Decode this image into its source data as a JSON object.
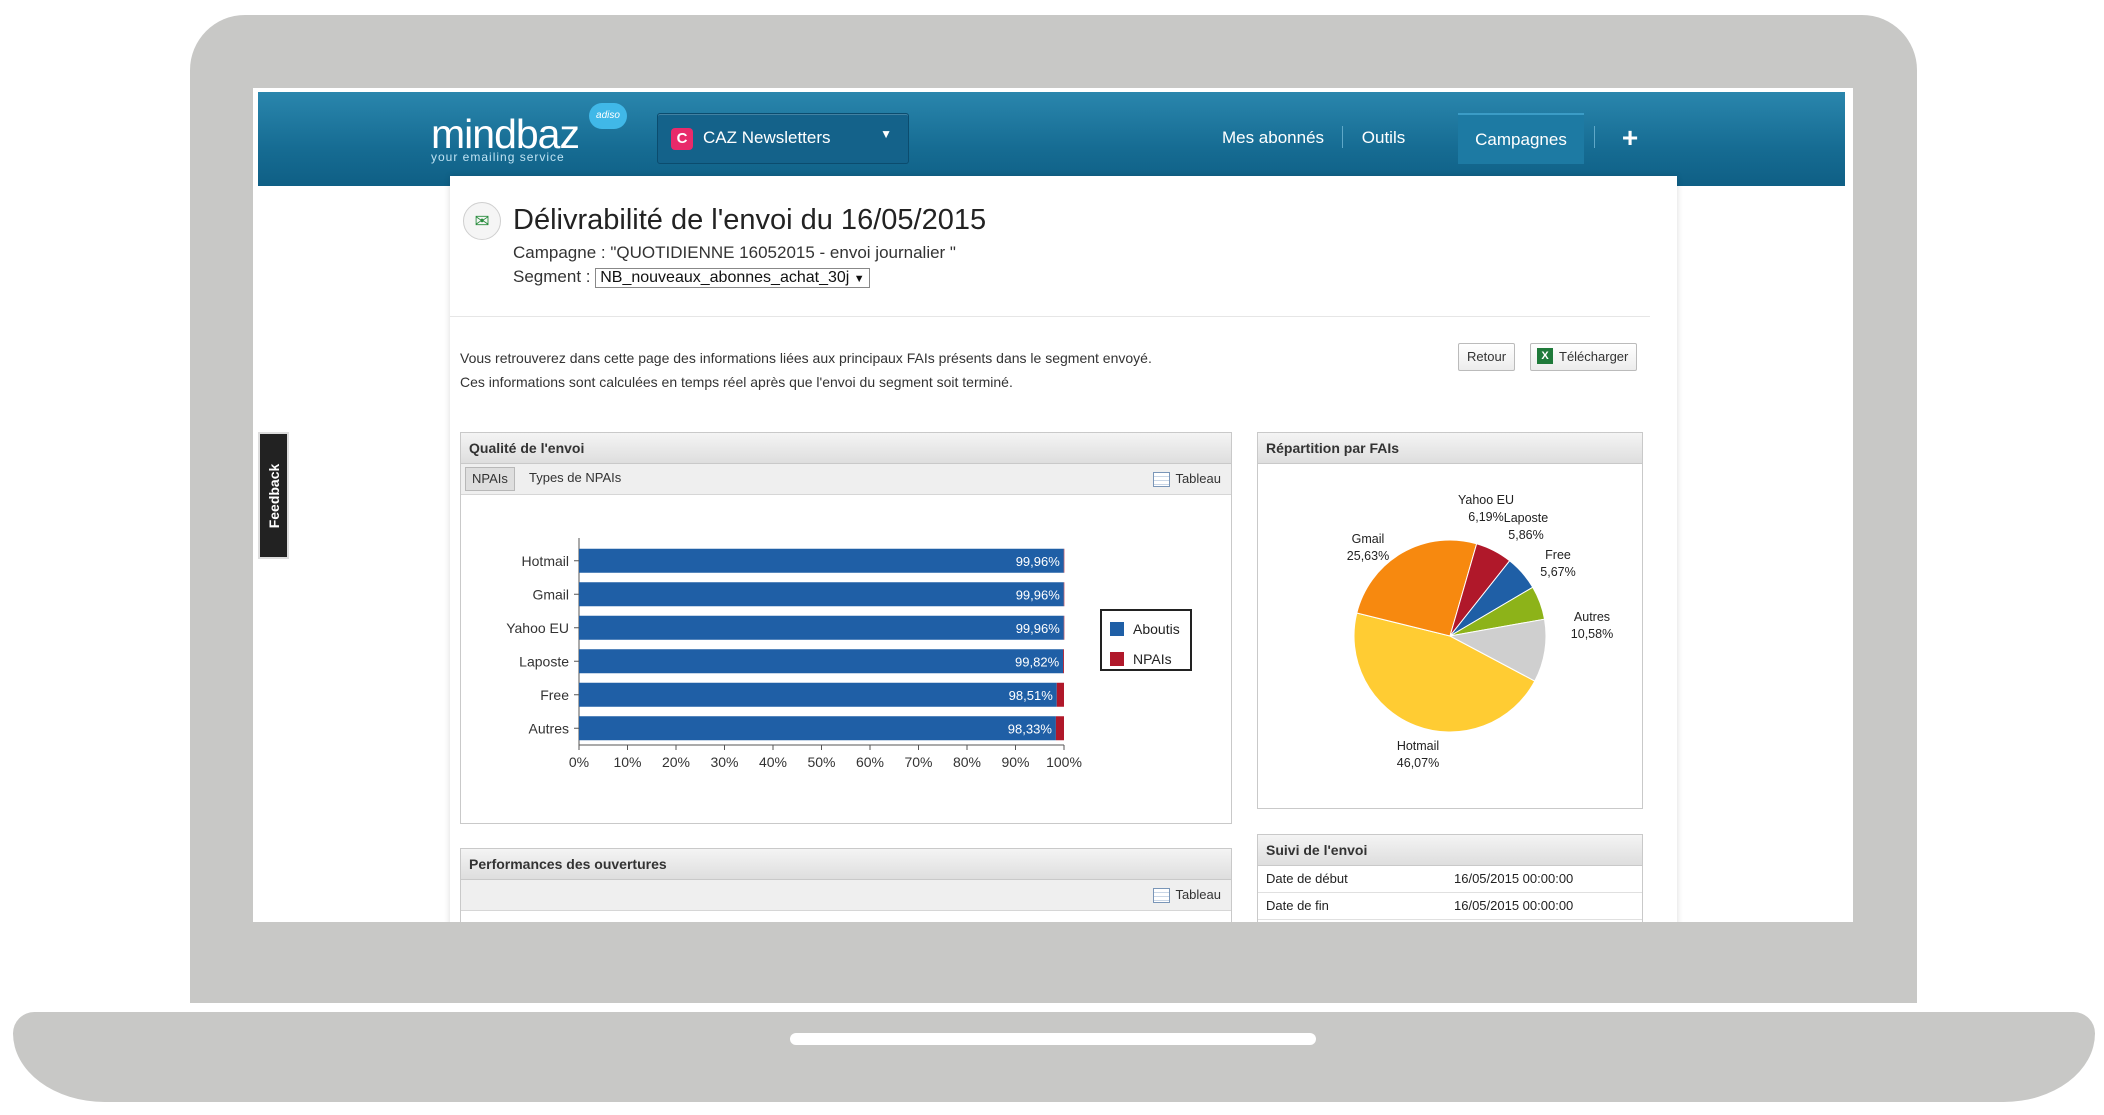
{
  "header": {
    "logo_main": "mindbaz",
    "logo_sub": "your emailing service",
    "logo_badge": "adiso",
    "account_icon": "C",
    "account_label": "CAZ Newsletters",
    "nav": [
      "Mes abonnés",
      "Outils",
      "Campagnes",
      "+"
    ]
  },
  "feedback_label": "Feedback",
  "page": {
    "title": "Délivrabilité de l'envoi du 16/05/2015",
    "campaign_label": "Campagne :",
    "campaign_value": "\"QUOTIDIENNE 16052015 - envoi journalier \"",
    "segment_label": "Segment :",
    "segment_value": "NB_nouveaux_abonnes_achat_30j",
    "intro_1": "Vous retrouverez dans cette page des informations liées aux principaux FAIs présents dans le segment envoyé.",
    "intro_2": "Ces informations sont calculées en temps réel après que l'envoi du segment soit terminé.",
    "btn_retour": "Retour",
    "btn_telecharger": "Télécharger"
  },
  "quality_panel": {
    "title": "Qualité de l'envoi",
    "tabs": [
      "NPAIs",
      "Types de NPAIs"
    ],
    "tableau": "Tableau"
  },
  "faipanel": {
    "title": "Répartition par FAIs"
  },
  "perf_panel": {
    "title": "Performances des ouvertures",
    "tableau": "Tableau"
  },
  "suivi_panel": {
    "title": "Suivi de l'envoi",
    "rows": [
      {
        "k": "Date de début",
        "v": "16/05/2015 00:00:00"
      },
      {
        "k": "Date de fin",
        "v": "16/05/2015 00:00:00"
      }
    ]
  },
  "colors": {
    "bar_blue": "#1f5fa6",
    "bar_red": "#b0182a"
  },
  "chart_data": [
    {
      "type": "bar",
      "orientation": "horizontal",
      "stacked": true,
      "categories": [
        "Hotmail",
        "Gmail",
        "Yahoo EU",
        "Laposte",
        "Free",
        "Autres"
      ],
      "series": [
        {
          "name": "Aboutis",
          "color": "#1f5fa6",
          "values": [
            99.96,
            99.96,
            99.96,
            99.82,
            98.51,
            98.33
          ],
          "labels": [
            "99,96%",
            "99,96%",
            "99,96%",
            "99,82%",
            "98,51%",
            "98,33%"
          ]
        },
        {
          "name": "NPAIs",
          "color": "#b0182a",
          "values": [
            0.04,
            0.04,
            0.04,
            0.18,
            1.49,
            1.67
          ]
        }
      ],
      "xticks": [
        "0%",
        "10%",
        "20%",
        "30%",
        "40%",
        "50%",
        "60%",
        "70%",
        "80%",
        "90%",
        "100%"
      ],
      "xlim": [
        0,
        100
      ],
      "legend": "right",
      "grid": false
    },
    {
      "type": "pie",
      "slices": [
        {
          "name": "Hotmail",
          "value": 46.07,
          "label": "46,07%",
          "color": "#ffcc33"
        },
        {
          "name": "Gmail",
          "value": 25.63,
          "label": "25,63%",
          "color": "#f7890f"
        },
        {
          "name": "Yahoo EU",
          "value": 6.19,
          "label": "6,19%",
          "color": "#b0182a"
        },
        {
          "name": "Laposte",
          "value": 5.86,
          "label": "5,86%",
          "color": "#1f5fa6"
        },
        {
          "name": "Free",
          "value": 5.67,
          "label": "5,67%",
          "color": "#8db319"
        },
        {
          "name": "Autres",
          "value": 10.58,
          "label": "10,58%",
          "color": "#cfcfcf"
        }
      ]
    }
  ]
}
